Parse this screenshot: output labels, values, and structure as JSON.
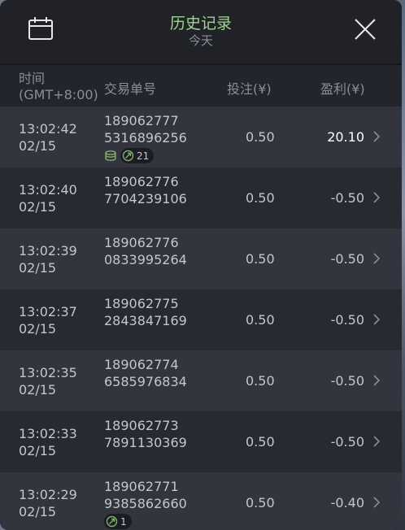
{
  "header": {
    "title": "历史记录",
    "subtitle": "今天"
  },
  "columns": {
    "time_line1": "时间",
    "time_line2": "(GMT+8:00)",
    "order": "交易单号",
    "bet": "投注(¥)",
    "profit": "盈利(¥)"
  },
  "rows": [
    {
      "time": "13:02:42",
      "date": "02/15",
      "order_a": "189062777",
      "order_b": "5316896256",
      "bet": "0.50",
      "profit": "20.10",
      "badge_count": "21"
    },
    {
      "time": "13:02:40",
      "date": "02/15",
      "order_a": "189062776",
      "order_b": "7704239106",
      "bet": "0.50",
      "profit": "-0.50"
    },
    {
      "time": "13:02:39",
      "date": "02/15",
      "order_a": "189062776",
      "order_b": "0833995264",
      "bet": "0.50",
      "profit": "-0.50"
    },
    {
      "time": "13:02:37",
      "date": "02/15",
      "order_a": "189062775",
      "order_b": "2843847169",
      "bet": "0.50",
      "profit": "-0.50"
    },
    {
      "time": "13:02:35",
      "date": "02/15",
      "order_a": "189062774",
      "order_b": "6585976834",
      "bet": "0.50",
      "profit": "-0.50"
    },
    {
      "time": "13:02:33",
      "date": "02/15",
      "order_a": "189062773",
      "order_b": "7891130369",
      "bet": "0.50",
      "profit": "-0.50"
    },
    {
      "time": "13:02:29",
      "date": "02/15",
      "order_a": "189062771",
      "order_b": "9385862660",
      "bet": "0.50",
      "profit": "-0.40",
      "badge_count": "1"
    }
  ],
  "colors": {
    "title": "#9fd48e",
    "badge_icon": "#7fb06a",
    "panel": "#23252c"
  },
  "icons": {
    "calendar": "calendar-icon",
    "close": "close-icon",
    "chevron": "chevron-right-icon",
    "coins": "coins-icon",
    "target": "target-icon"
  }
}
